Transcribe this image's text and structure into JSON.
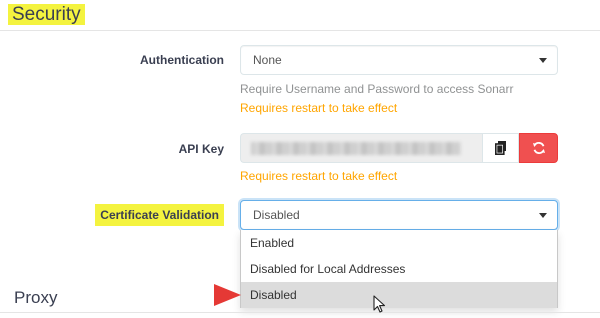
{
  "section": {
    "title": "Security"
  },
  "authentication": {
    "label": "Authentication",
    "value": "None",
    "help": "Require Username and Password to access Sonarr",
    "warning": "Requires restart to take effect"
  },
  "api_key": {
    "label": "API Key",
    "warning": "Requires restart to take effect",
    "copy_icon": "clipboard-icon",
    "regenerate_icon": "refresh-icon"
  },
  "certificate_validation": {
    "label": "Certificate Validation",
    "value": "Disabled",
    "options": [
      "Enabled",
      "Disabled for Local Addresses",
      "Disabled"
    ],
    "selected_index": 2
  },
  "next_section": {
    "title": "Proxy"
  },
  "colors": {
    "highlight": "#f4f33f",
    "warning": "#ffa500",
    "danger": "#f05050",
    "annotation_arrow": "#e53935"
  }
}
